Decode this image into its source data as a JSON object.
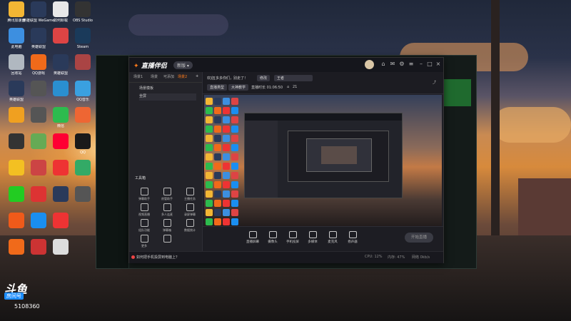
{
  "desktop": {
    "icons": [
      {
        "label": "腾讯加速器",
        "color": "#f3b634",
        "col": 0,
        "row": 0
      },
      {
        "label": "英雄联盟 WeGame版",
        "color": "#2a3a5a",
        "col": 1,
        "row": 0
      },
      {
        "label": "如何卸载",
        "color": "#e8e8e8",
        "col": 2,
        "row": 0
      },
      {
        "label": "OBS Studio",
        "color": "#333",
        "col": 3,
        "row": 0
      },
      {
        "label": "此电脑",
        "color": "#3d8fe0",
        "col": 0,
        "row": 1
      },
      {
        "label": "英雄联盟",
        "color": "#2a3a5a",
        "col": 1,
        "row": 1
      },
      {
        "label": "",
        "color": "#d44",
        "col": 2,
        "row": 1
      },
      {
        "label": "Steam",
        "color": "#1a3a5a",
        "col": 3,
        "row": 1
      },
      {
        "label": "回收站",
        "color": "#b0b8c0",
        "col": 0,
        "row": 2
      },
      {
        "label": "QQ游戏",
        "color": "#f06a1a",
        "col": 1,
        "row": 2
      },
      {
        "label": "英雄联盟",
        "color": "#2a3a5a",
        "col": 2,
        "row": 2
      },
      {
        "label": "",
        "color": "#a44",
        "col": 3,
        "row": 2
      },
      {
        "label": "英雄联盟",
        "color": "#2a3a5a",
        "col": 0,
        "row": 3
      },
      {
        "label": "",
        "color": "#555",
        "col": 1,
        "row": 3
      },
      {
        "label": "",
        "color": "#2a8fd0",
        "col": 2,
        "row": 3
      },
      {
        "label": "QQ音乐",
        "color": "#3aa0e0",
        "col": 3,
        "row": 3
      },
      {
        "label": "",
        "color": "#f0a020",
        "col": 0,
        "row": 4
      },
      {
        "label": "",
        "color": "#555",
        "col": 1,
        "row": 4
      },
      {
        "label": "微信",
        "color": "#2dbb4e",
        "col": 2,
        "row": 4
      },
      {
        "label": "",
        "color": "#e63",
        "col": 3,
        "row": 4
      },
      {
        "label": "",
        "color": "#333",
        "col": 0,
        "row": 5
      },
      {
        "label": "",
        "color": "#6a5",
        "col": 1,
        "row": 5
      },
      {
        "label": "",
        "color": "#f03",
        "col": 2,
        "row": 5
      },
      {
        "label": "QQ",
        "color": "#1a1a1a",
        "col": 3,
        "row": 5
      },
      {
        "label": "",
        "color": "#f3c022",
        "col": 0,
        "row": 6
      },
      {
        "label": "",
        "color": "#c44",
        "col": 1,
        "row": 6
      },
      {
        "label": "",
        "color": "#e33",
        "col": 2,
        "row": 6
      },
      {
        "label": "",
        "color": "#3a6",
        "col": 3,
        "row": 6
      },
      {
        "label": "",
        "color": "#2c2",
        "col": 0,
        "row": 7
      },
      {
        "label": "",
        "color": "#d33",
        "col": 1,
        "row": 7
      },
      {
        "label": "",
        "color": "#2a3a5a",
        "col": 2,
        "row": 7
      },
      {
        "label": "",
        "color": "#555",
        "col": 3,
        "row": 7
      },
      {
        "label": "",
        "color": "#f05a1a",
        "col": 0,
        "row": 8
      },
      {
        "label": "",
        "color": "#1a8ef0",
        "col": 1,
        "row": 8
      },
      {
        "label": "",
        "color": "#e33",
        "col": 2,
        "row": 8
      },
      {
        "label": "",
        "color": "#f06a1a",
        "col": 0,
        "row": 9
      },
      {
        "label": "",
        "color": "#c33",
        "col": 1,
        "row": 9
      },
      {
        "label": "",
        "color": "#ddd",
        "col": 2,
        "row": 9
      }
    ]
  },
  "app": {
    "brand": "直播伴侣",
    "version": "新版 ▾",
    "left_tabs": [
      "场景1",
      "场景",
      "可添加",
      "场景2"
    ],
    "scenes": [
      "场景模板",
      "全屏"
    ],
    "tools_title": "工具箱",
    "tools": [
      "弹幕助手",
      "房管助手",
      "主播任务",
      "视频直播",
      "多人连麦",
      "录屏弹幕",
      "组队功能",
      "弹幕箱",
      "数据统计",
      "更多",
      ""
    ],
    "info": {
      "title_text": "欢迎[多多你们，别走了！",
      "edit": "修改",
      "category": "王者",
      "tag1": "直播类型",
      "tag2": "大神教学",
      "extra": "直播时长 01:06:50",
      "viewers": "21"
    },
    "bottom_tools": [
      "直播屏幕",
      "摄像头",
      "手机投屏",
      "多媒体",
      "麦克风",
      "扬声器"
    ],
    "go_live": "开始直播",
    "footer_tip": "如何把手机投屏到电脑上？",
    "footer_right": [
      "CPU: 12%",
      "内存: 47%",
      "网络 0kb/s"
    ]
  },
  "watermark": {
    "brand": "斗鱼",
    "badge": "房间号",
    "room_id": "5108360"
  }
}
